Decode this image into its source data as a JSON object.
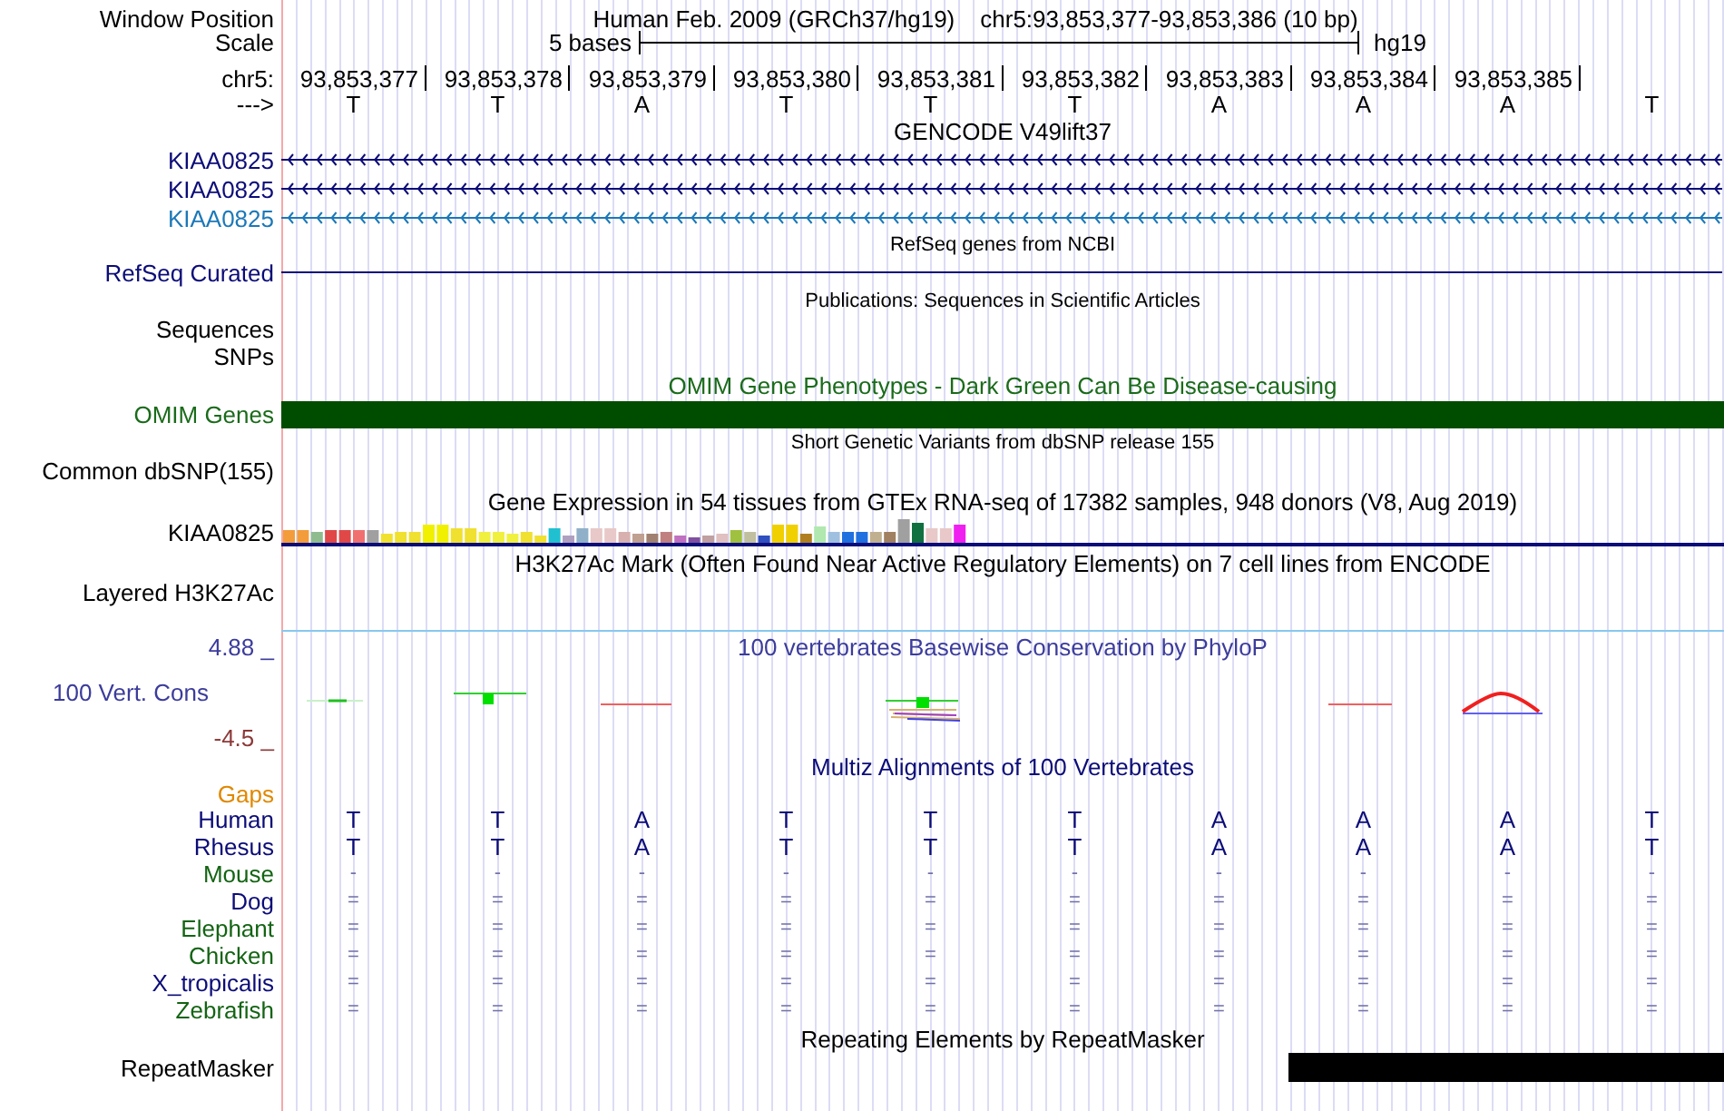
{
  "header": {
    "label": "Window Position",
    "title": "Human Feb. 2009 (GRCh37/hg19)",
    "position": "chr5:93,853,377-93,853,386 (10 bp)"
  },
  "scale": {
    "label": "Scale",
    "span": "5 bases",
    "assembly": "hg19"
  },
  "coordinates": {
    "label": "chr5:",
    "ticks": [
      "93,853,377",
      "93,853,378",
      "93,853,379",
      "93,853,380",
      "93,853,381",
      "93,853,382",
      "93,853,383",
      "93,853,384",
      "93,853,385"
    ]
  },
  "sequence": {
    "label": "--->",
    "bases": [
      "T",
      "T",
      "A",
      "T",
      "T",
      "T",
      "A",
      "A",
      "A",
      "T"
    ]
  },
  "tracks": [
    {
      "kind": "genes",
      "title": "GENCODE V49lift37",
      "color": "#000000",
      "items": [
        {
          "label": "KIAA0825",
          "color": "#0c0c78"
        },
        {
          "label": "KIAA0825",
          "color": "#0c0c78"
        },
        {
          "label": "KIAA0825",
          "color": "#1c78b8"
        }
      ]
    },
    {
      "kind": "line",
      "title": "RefSeq genes from NCBI",
      "color": "#000000",
      "label": {
        "text": "RefSeq Curated",
        "color": "#0c0c78"
      }
    },
    {
      "kind": "empty",
      "title": "Publications: Sequences in Scientific Articles",
      "color": "#000000",
      "labels": [
        "Sequences",
        "SNPs"
      ]
    },
    {
      "kind": "bar",
      "title": "OMIM Gene Phenotypes - Dark Green Can Be Disease-causing",
      "color": "#1a6b1a",
      "label": "OMIM Genes"
    },
    {
      "kind": "empty",
      "title": "Short Genetic Variants from dbSNP release 155",
      "color": "#000000",
      "labels": [
        "Common dbSNP(155)"
      ]
    },
    {
      "kind": "expression",
      "title": "Gene Expression in 54 tissues from GTEx RNA-seq of 17382 samples, 948 donors (V8, Aug 2019)",
      "color": "#000000",
      "label": "KIAA0825"
    },
    {
      "kind": "signal",
      "title": "H3K27Ac Mark (Often Found Near Active Regulatory Elements) on 7 cell lines from ENCODE",
      "color": "#000000",
      "label": "Layered H3K27Ac"
    },
    {
      "kind": "conservation",
      "title": "100 vertebrates Basewise Conservation by PhyloP",
      "color": "#3c3c9c",
      "label": "100 Vert. Cons",
      "max": "4.88 _",
      "min": "-4.5 _"
    },
    {
      "kind": "alignment",
      "title": "Multiz Alignments of 100 Vertebrates",
      "color": "#0c0c78",
      "gaps_label": "Gaps",
      "species": [
        {
          "name": "Human",
          "color": "#0c0c78",
          "kind": "sequence",
          "bases": [
            "T",
            "T",
            "A",
            "T",
            "T",
            "T",
            "A",
            "A",
            "A",
            "T"
          ]
        },
        {
          "name": "Rhesus",
          "color": "#0c0c78",
          "kind": "sequence",
          "bases": [
            "T",
            "T",
            "A",
            "T",
            "T",
            "T",
            "A",
            "A",
            "A",
            "T"
          ]
        },
        {
          "name": "Mouse",
          "color": "#136413",
          "kind": "summary",
          "bases": [
            "-",
            "-",
            "-",
            "-",
            "-",
            "-",
            "-",
            "-",
            "-",
            "-"
          ]
        },
        {
          "name": "Dog",
          "color": "#0c0c78",
          "kind": "summary",
          "bases": [
            "=",
            "=",
            "=",
            "=",
            "=",
            "=",
            "=",
            "=",
            "=",
            "="
          ]
        },
        {
          "name": "Elephant",
          "color": "#136413",
          "kind": "summary",
          "bases": [
            "=",
            "=",
            "=",
            "=",
            "=",
            "=",
            "=",
            "=",
            "=",
            "="
          ]
        },
        {
          "name": "Chicken",
          "color": "#136413",
          "kind": "summary",
          "bases": [
            "=",
            "=",
            "=",
            "=",
            "=",
            "=",
            "=",
            "=",
            "=",
            "="
          ]
        },
        {
          "name": "X_tropicalis",
          "color": "#0c0c78",
          "kind": "summary",
          "bases": [
            "=",
            "=",
            "=",
            "=",
            "=",
            "=",
            "=",
            "=",
            "=",
            "="
          ]
        },
        {
          "name": "Zebrafish",
          "color": "#136413",
          "kind": "summary",
          "bases": [
            "=",
            "=",
            "=",
            "=",
            "=",
            "=",
            "=",
            "=",
            "=",
            "="
          ]
        }
      ]
    },
    {
      "kind": "repeat",
      "title": "Repeating Elements by RepeatMasker",
      "color": "#000000",
      "label": "RepeatMasker"
    }
  ]
}
